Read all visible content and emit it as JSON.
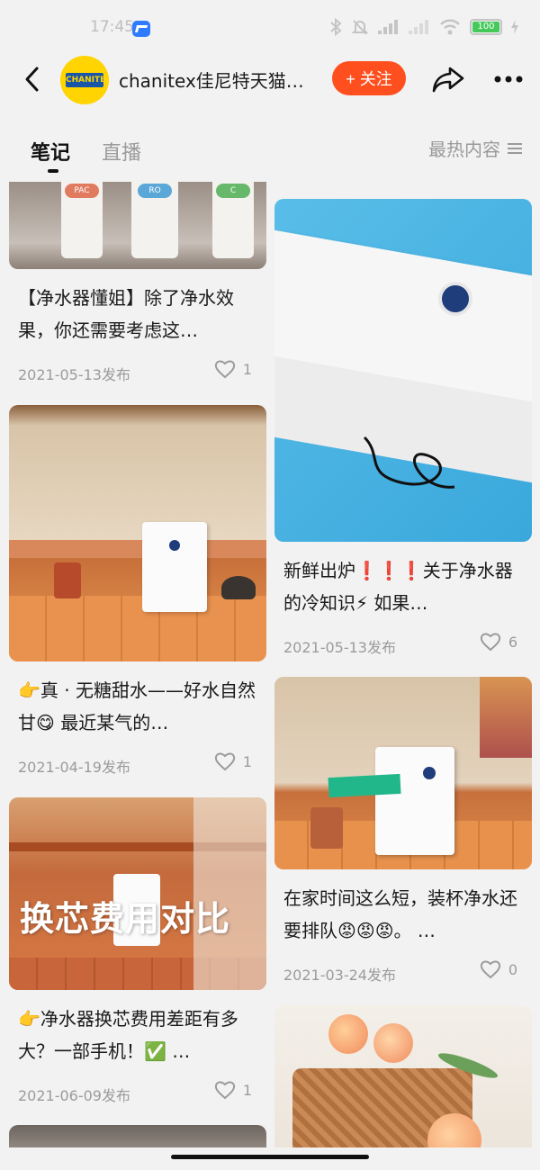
{
  "status_bar": {
    "time": "17:45",
    "battery": "100"
  },
  "header": {
    "shop_name": "chanitex佳尼特天猫…",
    "avatar_logo_text": "CHANITEX",
    "follow_label": "+ 关注"
  },
  "tabs": {
    "notes": "笔记",
    "live": "直播",
    "sort_label": "最热内容"
  },
  "posts": [
    {
      "title": "【净水器懂姐】除了净水效果，你还需要考虑这…",
      "date": "2021-05-13发布",
      "likes": "1"
    },
    {
      "title": "新鲜出炉❗❗❗关于净水器的冷知识⚡ 如果…",
      "date": "2021-05-13发布",
      "likes": "6"
    },
    {
      "title": "👉真 · 无糖甜水——好水自然甘😋 最近某气的…",
      "date": "2021-04-19发布",
      "likes": "1"
    },
    {
      "title": "在家时间这么短，装杯净水还要排队😡😡😡。 …",
      "date": "2021-03-24发布",
      "likes": "0"
    },
    {
      "title": "👉净水器换芯费用差距有多大？一部手机！✅ …",
      "date": "2021-06-09发布",
      "likes": "1"
    }
  ],
  "image_texts": {
    "filter_labels": [
      "PAC",
      "RO",
      "C"
    ],
    "comparison_overlay": "换芯费用对比"
  },
  "colors": {
    "accent": "#ff4f1e",
    "background": "#f2f2f2"
  }
}
